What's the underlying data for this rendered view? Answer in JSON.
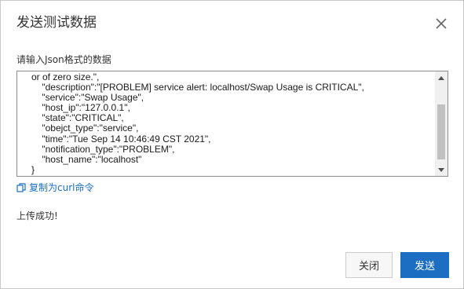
{
  "dialog": {
    "title": "发送测试数据",
    "close_icon": "close-icon"
  },
  "form": {
    "prompt": "请输入Json格式的数据",
    "json_lines": [
      "   or of zero size.\",",
      "       \"description\":\"[PROBLEM] service alert: localhost/Swap Usage is CRITICAL\",",
      "       \"service\":\"Swap Usage\",",
      "       \"host_ip\":\"127.0.0.1\",",
      "       \"state\":\"CRITICAL\",",
      "       \"obejct_type\":\"service\",",
      "       \"time\":\"Tue Sep 14 10:46:49 CST 2021\",",
      "       \"notification_type\":\"PROBLEM\",",
      "       \"host_name\":\"localhost\"",
      "   }"
    ]
  },
  "actions": {
    "copy_curl": "复制为curl命令",
    "copy_icon": "copy-icon"
  },
  "status": {
    "message": "上传成功!"
  },
  "footer": {
    "close_label": "关闭",
    "send_label": "发送"
  },
  "colors": {
    "primary": "#1b6ec2",
    "border": "#c8c8c8",
    "text": "#333333"
  }
}
